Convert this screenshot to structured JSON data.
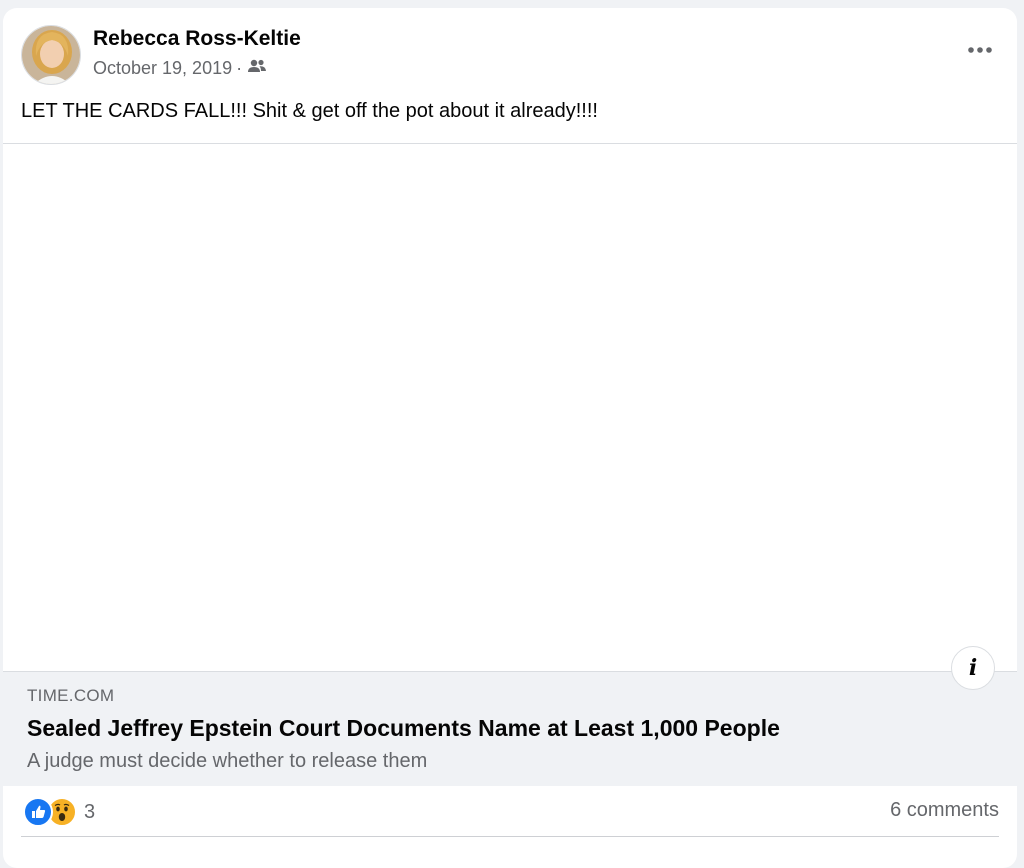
{
  "post": {
    "author": "Rebecca Ross-Keltie",
    "date": "October 19, 2019",
    "separator": "·",
    "audience_icon": "friends-icon",
    "more_icon": "more-options-icon",
    "text": "LET THE CARDS FALL!!! Shit & get off the pot about it already!!!!"
  },
  "link_preview": {
    "domain": "TIME.COM",
    "title": "Sealed Jeffrey Epstein Court Documents Name at Least 1,000 People",
    "description": "A judge must decide whether to release them",
    "info_icon_label": "i"
  },
  "footer": {
    "reaction_icons": [
      "like-icon",
      "wow-icon"
    ],
    "reaction_count": "3",
    "comments": "6 comments"
  },
  "colors": {
    "like": "#1877f2",
    "wow": "#f7b125",
    "secondary_text": "#65676b",
    "link_bg": "#f0f2f5"
  }
}
